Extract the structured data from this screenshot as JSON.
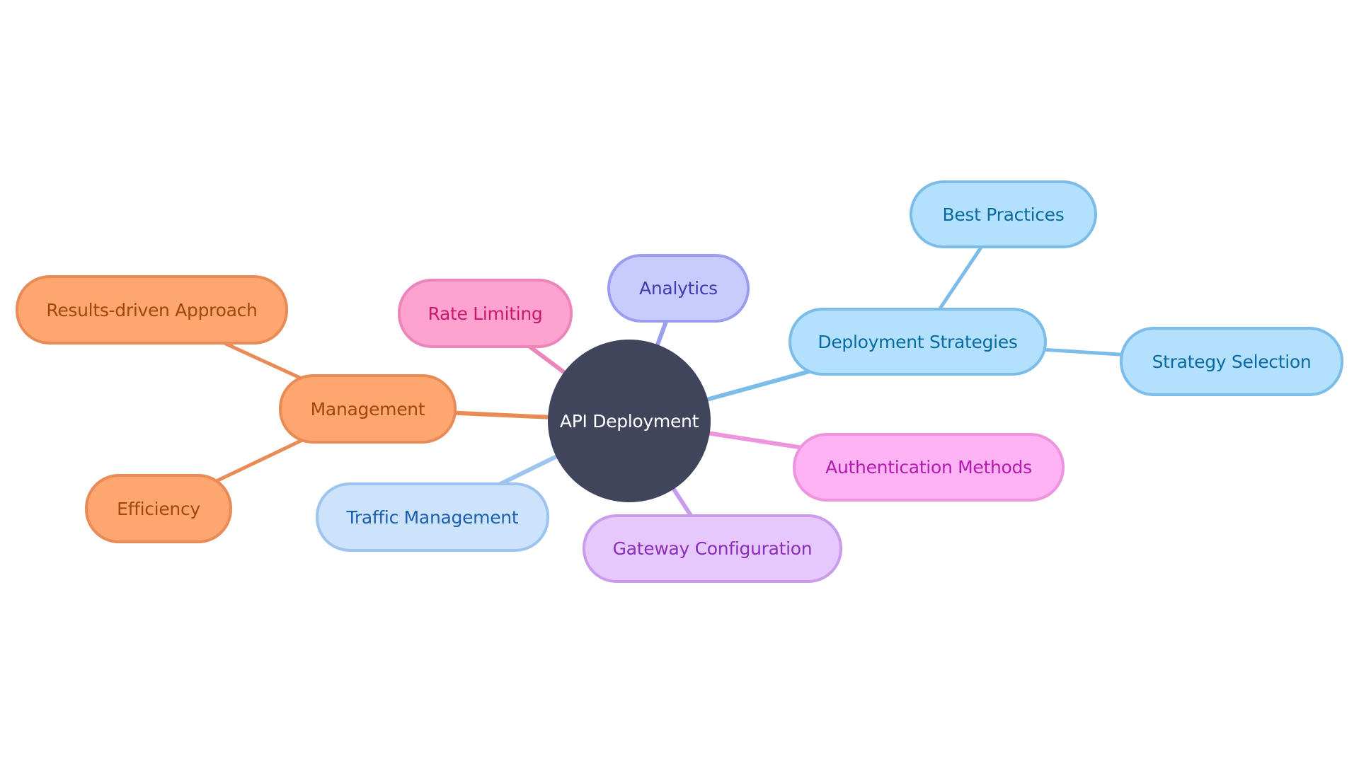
{
  "diagram": {
    "type": "mindmap",
    "root": {
      "id": "root",
      "label": "API Deployment",
      "fill": "#41455c",
      "text_color": "#ffffff"
    },
    "nodes": [
      {
        "id": "management",
        "label": "Management",
        "parent": "root",
        "fill": "#fda670",
        "stroke": "#e98b57",
        "text_color": "#a0470a",
        "edge_color": "#e98b57"
      },
      {
        "id": "results",
        "label": "Results-driven Approach",
        "parent": "management",
        "fill": "#fda670",
        "stroke": "#e98b57",
        "text_color": "#a0470a",
        "edge_color": "#e98b57"
      },
      {
        "id": "efficiency",
        "label": "Efficiency",
        "parent": "management",
        "fill": "#fda670",
        "stroke": "#e98b57",
        "text_color": "#a0470a",
        "edge_color": "#e98b57"
      },
      {
        "id": "rate",
        "label": "Rate Limiting",
        "parent": "root",
        "fill": "#fea2cf",
        "stroke": "#ea86b9",
        "text_color": "#c8196e",
        "edge_color": "#ea86b9"
      },
      {
        "id": "analytics",
        "label": "Analytics",
        "parent": "root",
        "fill": "#cacbfd",
        "stroke": "#9b9ded",
        "text_color": "#3b3cb0",
        "edge_color": "#9b9ded"
      },
      {
        "id": "deploy",
        "label": "Deployment Strategies",
        "parent": "root",
        "fill": "#b3e0fd",
        "stroke": "#7bbce9",
        "text_color": "#0a6aa0",
        "edge_color": "#7bbce9"
      },
      {
        "id": "best",
        "label": "Best Practices",
        "parent": "deploy",
        "fill": "#b3e0fd",
        "stroke": "#7bbce9",
        "text_color": "#0a6aa0",
        "edge_color": "#7bbce9"
      },
      {
        "id": "selection",
        "label": "Strategy Selection",
        "parent": "deploy",
        "fill": "#b3e0fd",
        "stroke": "#7bbce9",
        "text_color": "#0a6aa0",
        "edge_color": "#7bbce9"
      },
      {
        "id": "auth",
        "label": "Authentication Methods",
        "parent": "root",
        "fill": "#fdb2f3",
        "stroke": "#ee94dd",
        "text_color": "#b21cad",
        "edge_color": "#ee94dd"
      },
      {
        "id": "gateway",
        "label": "Gateway Configuration",
        "parent": "root",
        "fill": "#e6c8fd",
        "stroke": "#c99cec",
        "text_color": "#8a2eb8",
        "edge_color": "#c99cec"
      },
      {
        "id": "traffic",
        "label": "Traffic Management",
        "parent": "root",
        "fill": "#cde3fb",
        "stroke": "#9cc4ee",
        "text_color": "#1a5fb0",
        "edge_color": "#9cc4ee"
      }
    ]
  }
}
